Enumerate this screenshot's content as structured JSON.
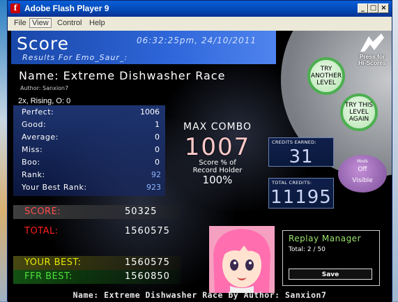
{
  "window": {
    "title": "Adobe Flash Player 9"
  },
  "menu": [
    {
      "label": "File"
    },
    {
      "label": "View"
    },
    {
      "label": "Control"
    },
    {
      "label": "Help"
    }
  ],
  "header": {
    "title": "Score",
    "datetime": "06:32:25pm, 24/10/2011",
    "results_for": "Results For Emo_Saur_:"
  },
  "song": {
    "name": "Name: Extreme Dishwasher Race",
    "author": "Author: Sanxion7",
    "mods": "2x, Rising, O: 0"
  },
  "stats": [
    {
      "label": "Perfect:",
      "value": "1006"
    },
    {
      "label": "Good:",
      "value": "1"
    },
    {
      "label": "Average:",
      "value": "0"
    },
    {
      "label": "Miss:",
      "value": "0"
    },
    {
      "label": "Boo:",
      "value": "0"
    },
    {
      "label": "Rank:",
      "value": "92"
    },
    {
      "label": "Your Best Rank:",
      "value": "923"
    }
  ],
  "combo": {
    "label": "MAX COMBO",
    "value": "1007",
    "pct_label_1": "Score % of",
    "pct_label_2": "Record Holder",
    "pct_value": "100%"
  },
  "credits": {
    "earned_label": "CREDITS EARNED:",
    "earned_value": "31",
    "total_label": "TOTAL CREDITS:",
    "total_value": "11195"
  },
  "mods_button": {
    "title": "Mods",
    "state": "Off",
    "visibility": "Visible"
  },
  "hiscores": {
    "label_1": "Press for",
    "label_2": "Hi-Scores"
  },
  "buttons": {
    "try_another": "TRY ANOTHER LEVEL",
    "try_again": "TRY THIS LEVEL AGAIN"
  },
  "scores": {
    "score_label": "SCORE:",
    "score_value": "50325",
    "total_label": "TOTAL:",
    "total_value": "1560575",
    "best_label": "YOUR BEST:",
    "best_value": "1560575",
    "ffr_label": "FFR BEST:",
    "ffr_value": "1560850"
  },
  "replay": {
    "title": "Replay Manager",
    "total": "Total: 2 / 50",
    "save": "Save"
  },
  "footer": "Name: Extreme Dishwasher Race by Author: Sanxion7",
  "colors": {
    "header_blue": "#2f66d9",
    "score_red": "#ff4d4d",
    "best_yellow": "#e6e600",
    "ffr_green": "#4fdc3c",
    "button_green": "#4caf50",
    "mods_purple": "#9b6bb5"
  }
}
